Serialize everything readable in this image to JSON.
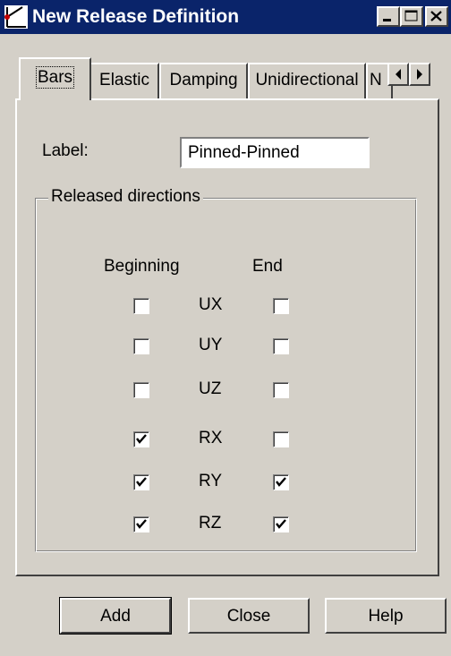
{
  "window": {
    "title": "New Release Definition"
  },
  "tabs": [
    "Bars",
    "Elastic",
    "Damping",
    "Unidirectional",
    "N"
  ],
  "label_field": {
    "label": "Label:",
    "value": "Pinned-Pinned"
  },
  "group": {
    "title": "Released directions",
    "col_beginning": "Beginning",
    "col_end": "End",
    "rows": [
      {
        "dir": "UX",
        "beginning": false,
        "end": false
      },
      {
        "dir": "UY",
        "beginning": false,
        "end": false
      },
      {
        "dir": "UZ",
        "beginning": false,
        "end": false
      },
      {
        "dir": "RX",
        "beginning": true,
        "end": false
      },
      {
        "dir": "RY",
        "beginning": true,
        "end": true
      },
      {
        "dir": "RZ",
        "beginning": true,
        "end": true
      }
    ]
  },
  "buttons": {
    "add": "Add",
    "close": "Close",
    "help": "Help"
  },
  "colors": {
    "titlebar": "#0a246a",
    "face": "#d4d0c8"
  }
}
